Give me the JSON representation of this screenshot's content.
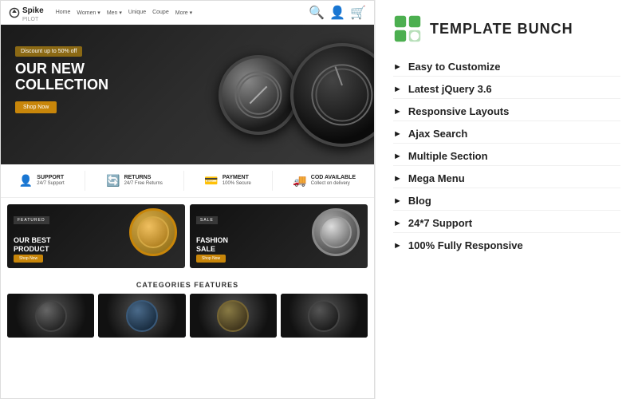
{
  "left": {
    "navbar": {
      "logo": "Spike",
      "logo_sub": "PILOT",
      "links": [
        "Home",
        "Women",
        "Men",
        "Unique",
        "Coupe",
        "More"
      ]
    },
    "hero": {
      "discount": "Discount up to 50% off",
      "title_line1": "OUR NEW",
      "title_line2": "COLLECTION",
      "shop_btn": "Shop Now"
    },
    "features": [
      {
        "icon": "👤",
        "title": "SUPPORT",
        "sub": "24/7 Support"
      },
      {
        "icon": "🔄",
        "title": "RETURNS",
        "sub": "24/7 Free Returns"
      },
      {
        "icon": "💳",
        "title": "PAYMENT",
        "sub": "100% Secure"
      },
      {
        "icon": "🚚",
        "title": "COD AVAILABLE",
        "sub": "Collect on delivery"
      }
    ],
    "products": [
      {
        "tag": "featured",
        "title": "OUR BEST\nPRODUCT",
        "btn": "Shop Now",
        "watch_type": "gold"
      },
      {
        "tag": "sale",
        "title": "FASHION\nSALE",
        "btn": "Shop Now",
        "watch_type": "silver"
      }
    ],
    "categories_title": "CATEGORIES FEATURES"
  },
  "right": {
    "brand": "TEMPLATE BUNCH",
    "features": [
      "Easy to Customize",
      "Latest jQuery 3.6",
      "Responsive Layouts",
      "Ajax Search",
      "Multiple Section",
      "Mega Menu",
      "Blog",
      "24*7 Support",
      "100% Fully Responsive"
    ]
  }
}
